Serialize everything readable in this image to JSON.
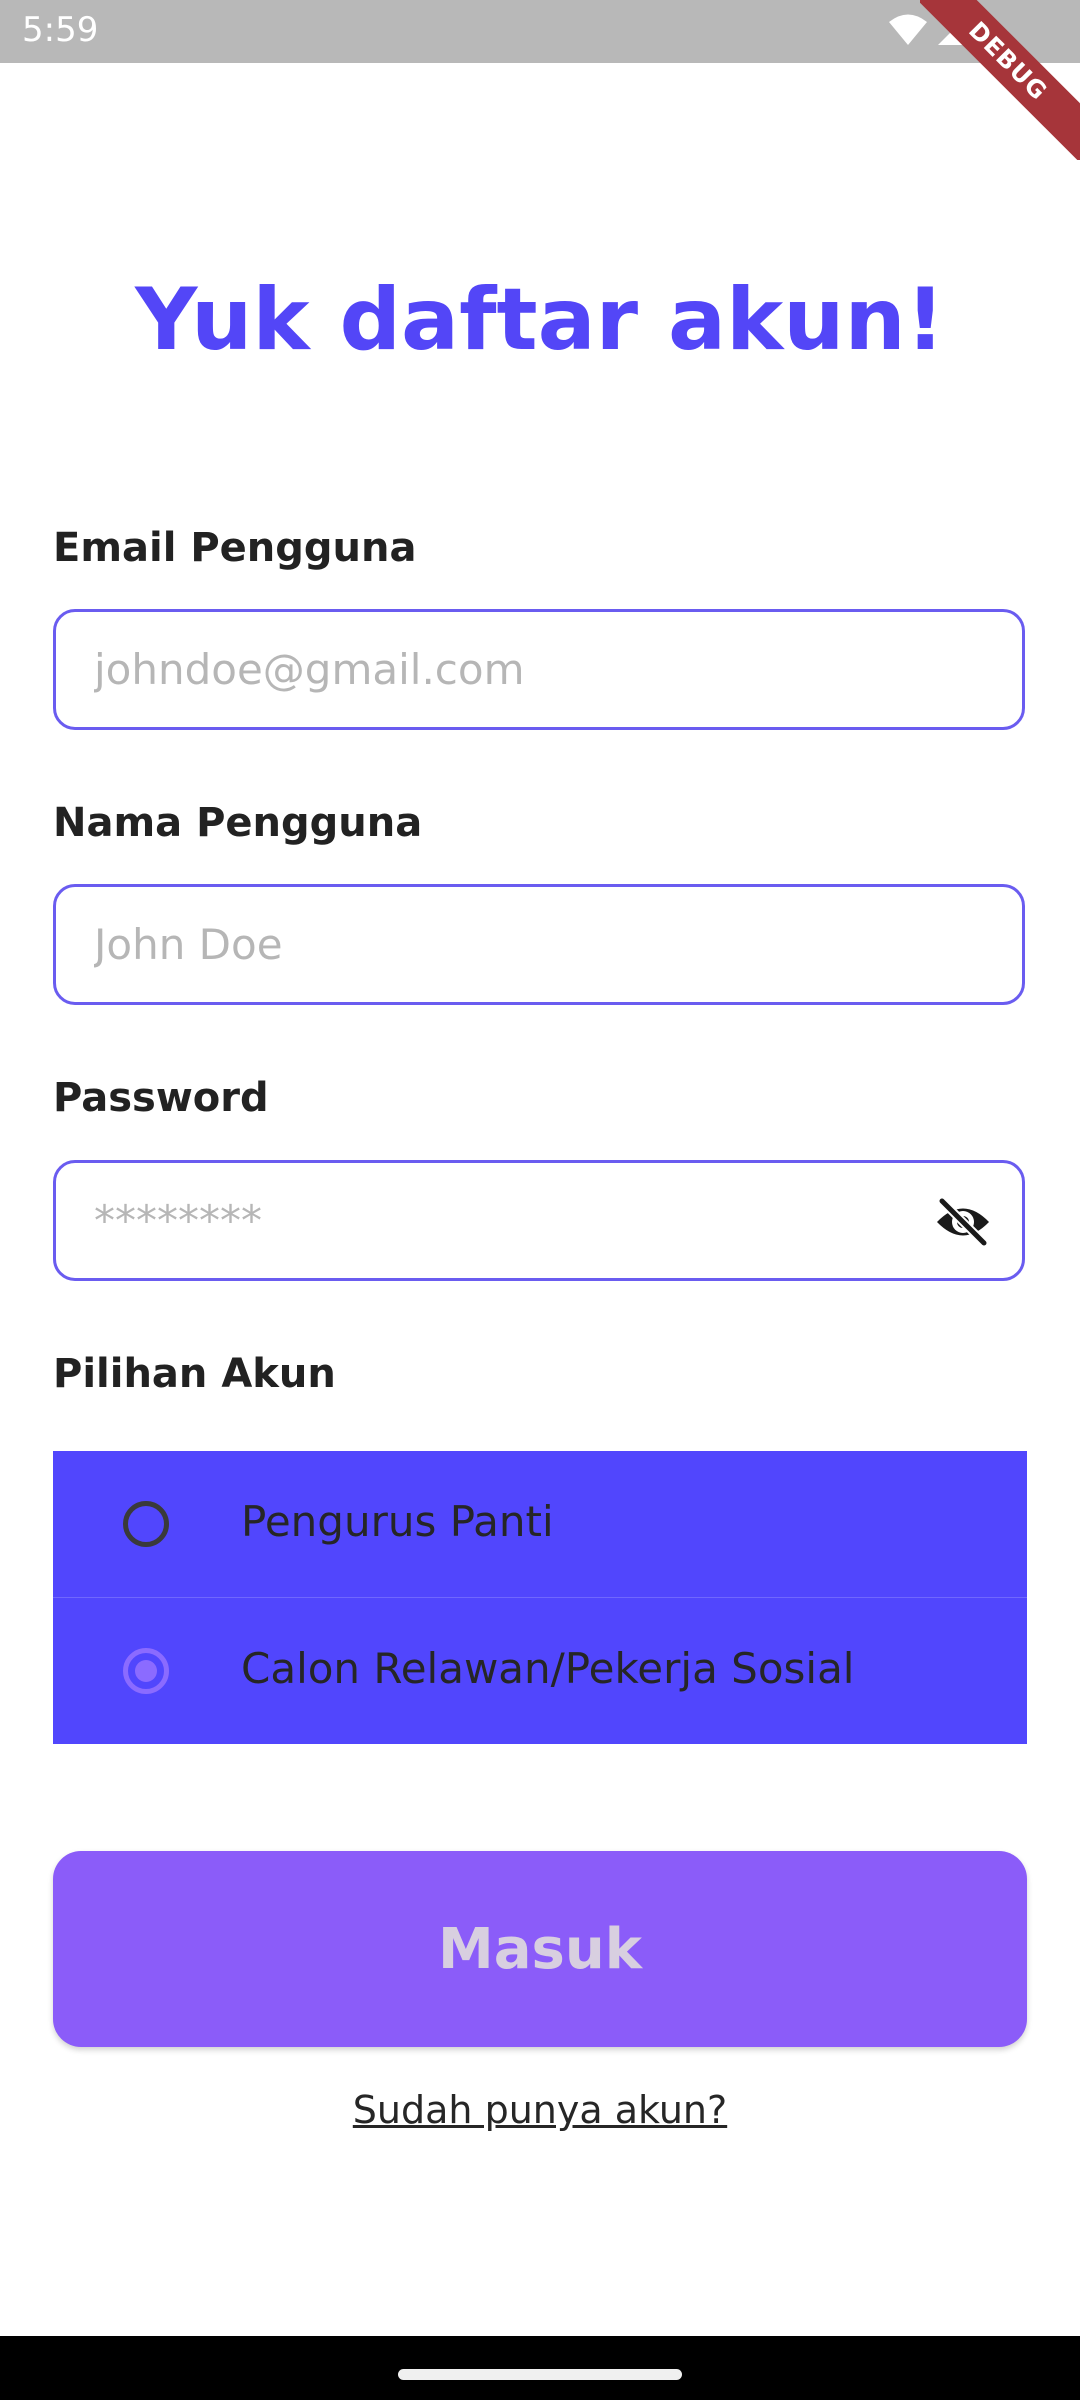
{
  "status_bar": {
    "time": "5:59",
    "debug_label": "DEBUG"
  },
  "page": {
    "title": "Yuk daftar akun!"
  },
  "form": {
    "email": {
      "label": "Email Pengguna",
      "placeholder": "johndoe@gmail.com",
      "value": ""
    },
    "name": {
      "label": "Nama Pengguna",
      "placeholder": "John Doe",
      "value": ""
    },
    "password": {
      "label": "Password",
      "placeholder": "********",
      "value": "",
      "visibility_icon": "visibility-off-icon"
    },
    "account_type": {
      "label": "Pilihan Akun",
      "options": [
        {
          "label": "Pengurus Panti",
          "selected": false
        },
        {
          "label": "Calon Relawan/Pekerja Sosial",
          "selected": true
        }
      ]
    }
  },
  "actions": {
    "submit_label": "Masuk",
    "login_link": "Sudah punya akun?"
  },
  "colors": {
    "primary": "#5346f7",
    "radio_group_bg": "#5146fd",
    "button_bg": "#8b5cf9",
    "button_text": "#d8cfe0",
    "field_border": "#6a5cf0",
    "debug_ribbon": "#a6353a"
  }
}
